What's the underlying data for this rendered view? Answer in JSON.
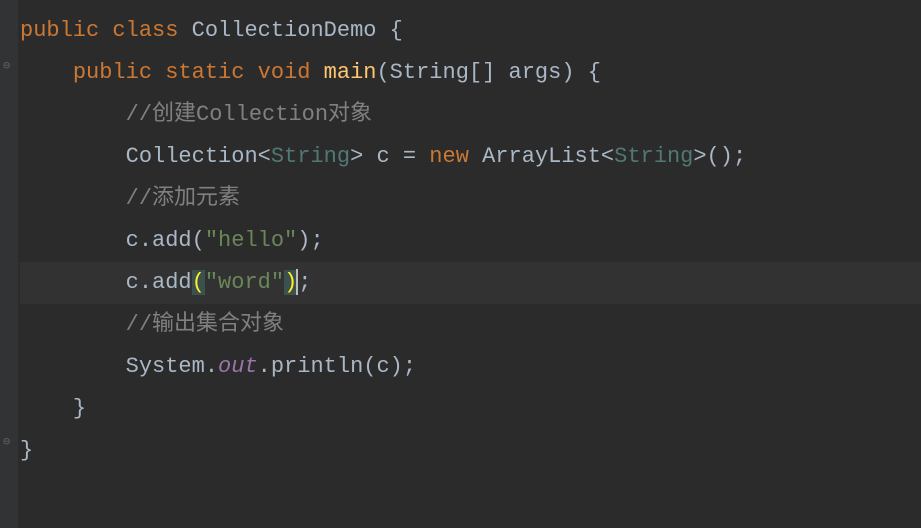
{
  "code": {
    "line1": {
      "kw_public": "public",
      "kw_class": "class",
      "class_name": "CollectionDemo",
      "brace": " {"
    },
    "line2": {
      "indent": "    ",
      "kw_public": "public",
      "kw_static": "static",
      "kw_void": "void",
      "method": "main",
      "params": "(String[] args) {"
    },
    "line3": {
      "indent": "        ",
      "comment": "//创建Collection对象"
    },
    "line4": {
      "indent": "        ",
      "text1": "Collection<",
      "type1": "String",
      "text2": "> c = ",
      "kw_new": "new",
      "text3": " ArrayList<",
      "type2": "String",
      "text4": ">();"
    },
    "line5": {
      "indent": "        ",
      "comment": "//添加元素"
    },
    "line6": {
      "indent": "        ",
      "text1": "c.add(",
      "str": "\"hello\"",
      "text2": ");"
    },
    "line7": {
      "indent": "        ",
      "text1": "c.add",
      "paren_open": "(",
      "str": "\"word\"",
      "paren_close": ")",
      "text2": ";"
    },
    "line8": {
      "indent": "        ",
      "comment": "//输出集合对象"
    },
    "line9": {
      "indent": "        ",
      "text1": "System.",
      "field": "out",
      "text2": ".println(c);"
    },
    "line10": {
      "indent": "    ",
      "brace": "}"
    },
    "line11": {
      "brace": "}"
    }
  },
  "gutter": {
    "collapse1": "⊖",
    "collapse2": "⊖"
  }
}
